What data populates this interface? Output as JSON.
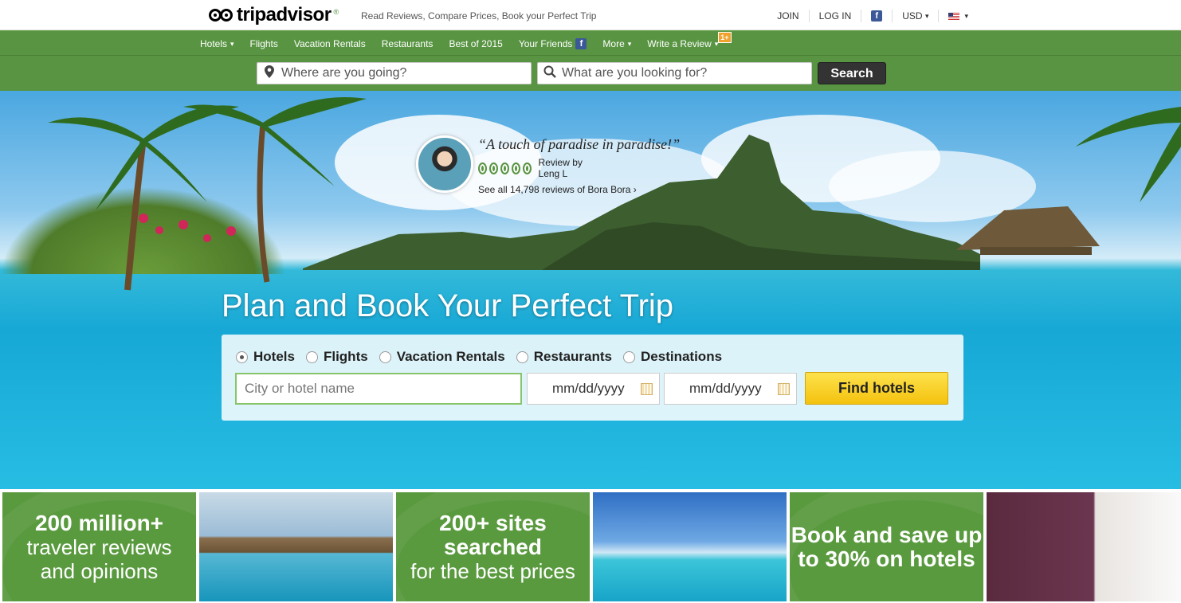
{
  "header": {
    "logo_text_a": "trip",
    "logo_text_b": "advisor",
    "tagline": "Read Reviews, Compare Prices, Book your Perfect Trip",
    "join": "JOIN",
    "login": "LOG IN",
    "currency": "USD"
  },
  "nav": {
    "items": [
      {
        "label": "Hotels",
        "chevron": true
      },
      {
        "label": "Flights",
        "chevron": false
      },
      {
        "label": "Vacation Rentals",
        "chevron": false
      },
      {
        "label": "Restaurants",
        "chevron": false
      },
      {
        "label": "Best of 2015",
        "chevron": false
      },
      {
        "label": "Your Friends",
        "chevron": false
      },
      {
        "label": "More",
        "chevron": true
      },
      {
        "label": "Write a Review",
        "chevron": true
      }
    ],
    "review_badge": "1+"
  },
  "search": {
    "where_placeholder": "Where are you going?",
    "what_placeholder": "What are you looking for?",
    "button": "Search"
  },
  "hero": {
    "quote": "“A touch of paradise in paradise!”",
    "rating_bubbles": 5,
    "review_by": "Review by Leng L",
    "see_all": "See all 14,798 reviews of Bora Bora ›",
    "headline": "Plan and Book Your Perfect Trip"
  },
  "planner": {
    "options": [
      {
        "label": "Hotels",
        "selected": true
      },
      {
        "label": "Flights",
        "selected": false
      },
      {
        "label": "Vacation Rentals",
        "selected": false
      },
      {
        "label": "Restaurants",
        "selected": false
      },
      {
        "label": "Destinations",
        "selected": false
      }
    ],
    "city_placeholder": "City or hotel name",
    "checkin_placeholder": "mm/dd/yyyy",
    "checkout_placeholder": "mm/dd/yyyy",
    "find_button": "Find hotels"
  },
  "tiles": {
    "t1_big": "200 million+",
    "t1_line2": "traveler reviews",
    "t1_line3": "and opinions",
    "t2_line1": "200+ sites",
    "t2_line2": "searched",
    "t2_line3": "for the best prices",
    "t3_line1": "Book and save up",
    "t3_line2": "to 30% on hotels"
  },
  "colors": {
    "brand_green": "#589442",
    "find_yellow": "#f7c823"
  }
}
